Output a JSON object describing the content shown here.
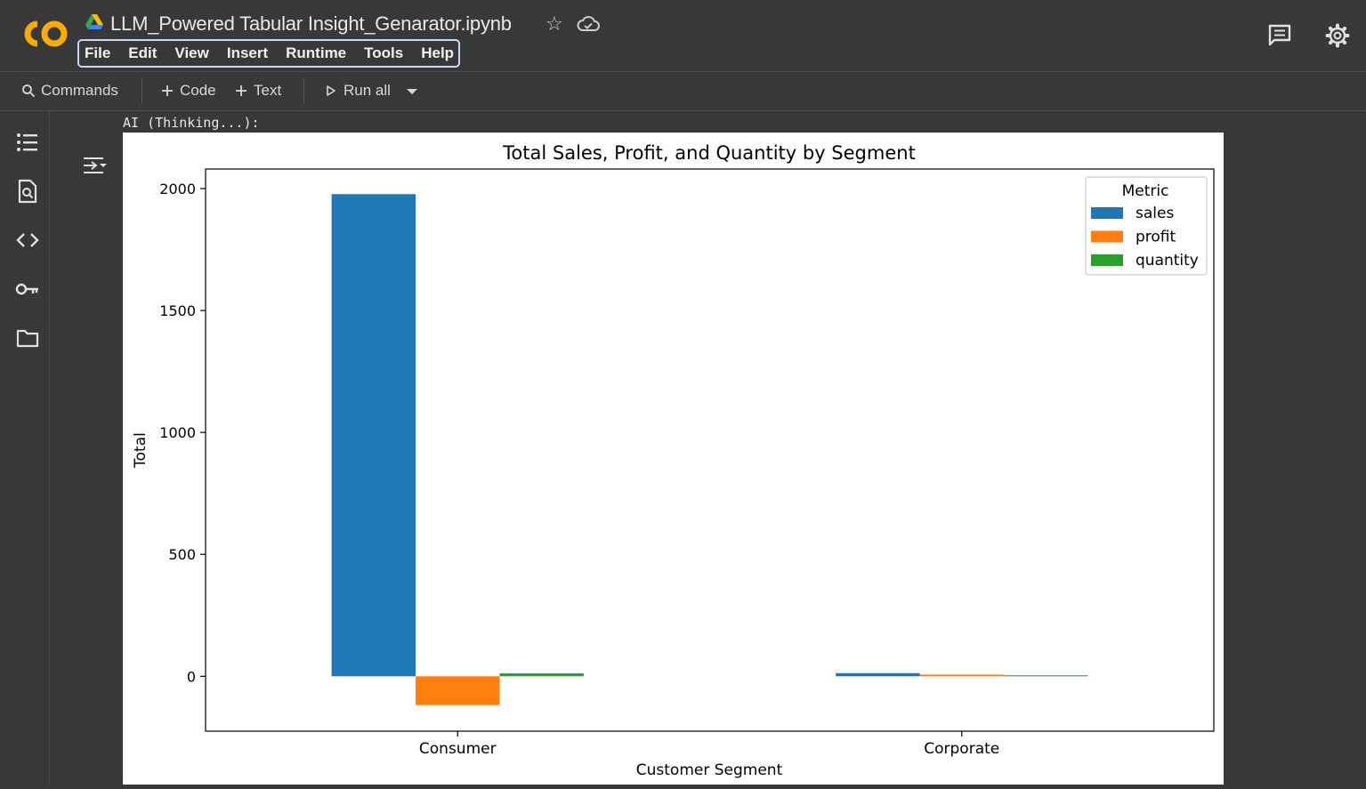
{
  "app": {
    "notebook_title": "LLM_Powered Tabular Insight_Genarator.ipynb",
    "menu": [
      "File",
      "Edit",
      "View",
      "Insert",
      "Runtime",
      "Tools",
      "Help"
    ]
  },
  "toolbar": {
    "commands_label": "Commands",
    "code_label": "Code",
    "text_label": "Text",
    "run_all_label": "Run all"
  },
  "icons": {
    "logo": "colab-logo",
    "header": [
      "drive-icon",
      "star-icon",
      "cloud-icon",
      "comment-icon",
      "settings-icon"
    ],
    "rail": [
      "table-of-contents-icon",
      "find-icon",
      "code-snippets-icon",
      "secrets-key-icon",
      "files-folder-icon"
    ]
  },
  "colors": {
    "logo_orange": "#f9ab00",
    "sales": "#1f77b4",
    "profit": "#ff7f0e",
    "quantity": "#2ca02c"
  },
  "cell_output": {
    "status_text": "AI (Thinking...):"
  },
  "chart_data": {
    "type": "bar",
    "title": "Total Sales, Profit, and Quantity by Segment",
    "xlabel": "Customer Segment",
    "ylabel": "Total",
    "categories": [
      "Consumer",
      "Corporate"
    ],
    "series": [
      {
        "name": "sales",
        "color": "#1f77b4",
        "values": [
          1977,
          13
        ]
      },
      {
        "name": "profit",
        "color": "#ff7f0e",
        "values": [
          -118,
          7
        ]
      },
      {
        "name": "quantity",
        "color": "#2ca02c",
        "values": [
          12,
          4
        ]
      }
    ],
    "ylim": [
      -225,
      2080
    ],
    "yticks": [
      0,
      500,
      1000,
      1500,
      2000
    ],
    "legend_title": "Metric",
    "legend_position": "top-right",
    "grid": false
  }
}
